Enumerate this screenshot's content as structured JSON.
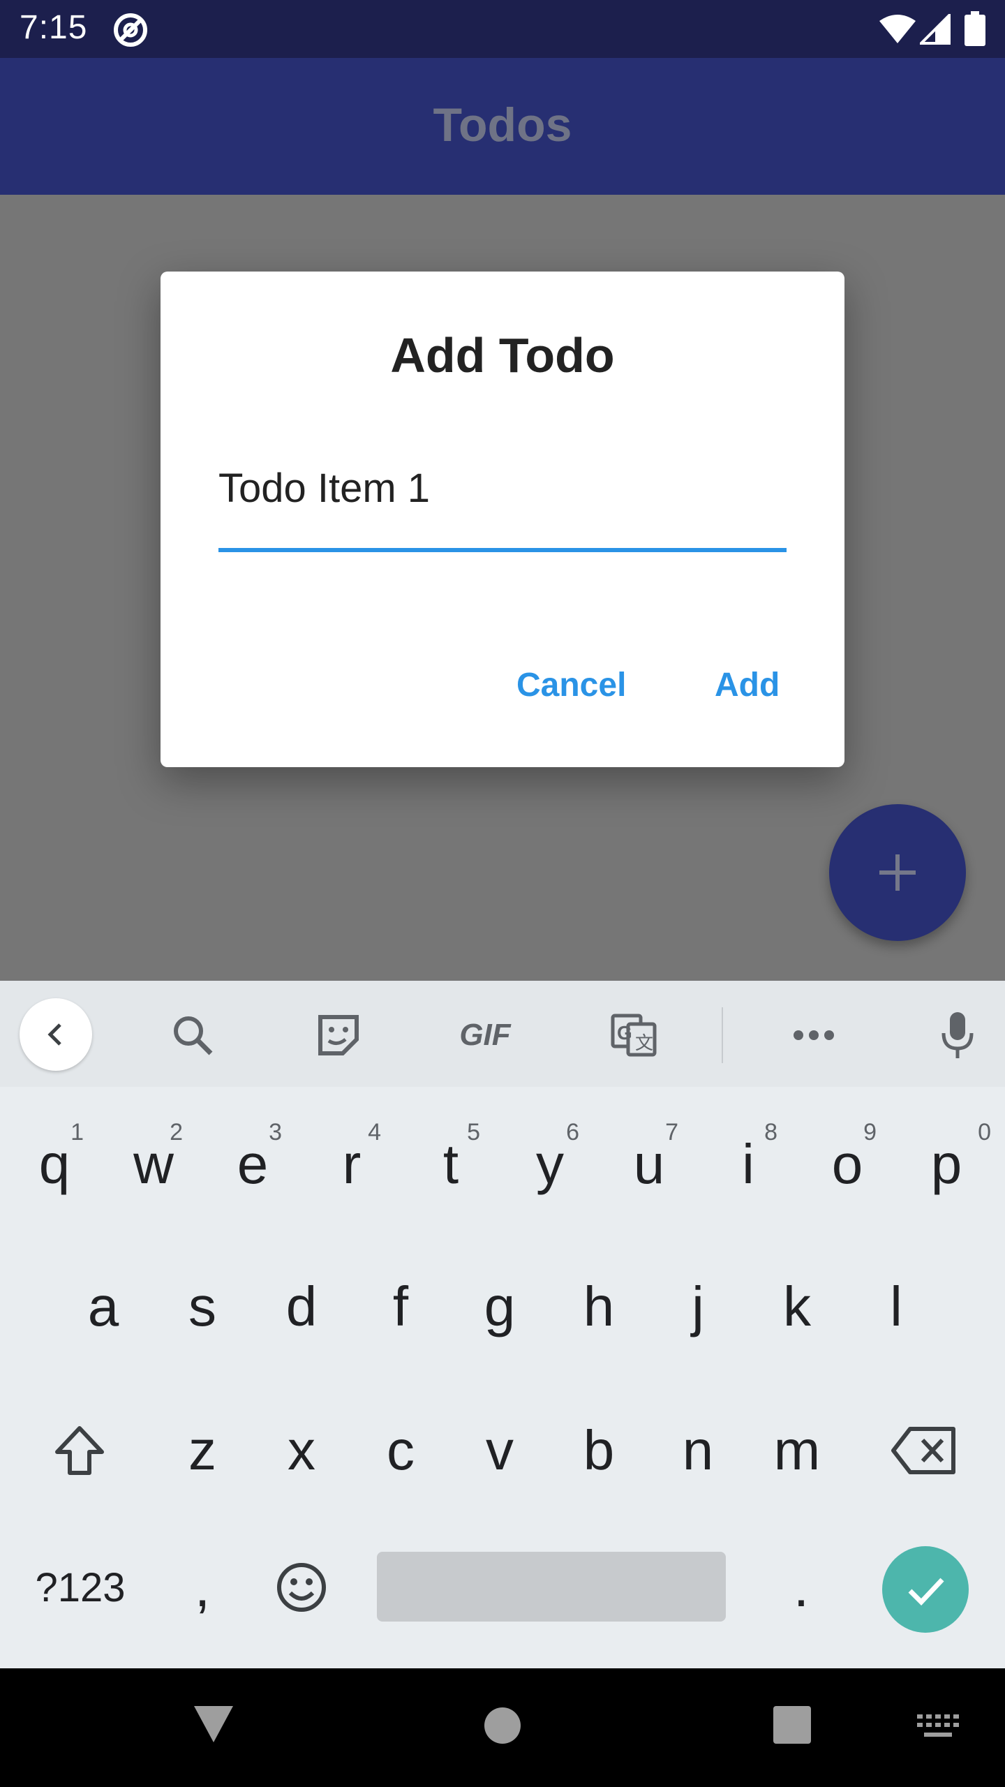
{
  "status_bar": {
    "time": "7:15"
  },
  "app_bar": {
    "title": "Todos"
  },
  "dialog": {
    "title": "Add Todo",
    "input_value": "Todo Item 1",
    "cancel_label": "Cancel",
    "add_label": "Add"
  },
  "keyboard": {
    "strip_icons": [
      "back-icon",
      "search-icon",
      "sticker-icon",
      "gif-icon",
      "translate-icon",
      "more-icon",
      "mic-icon"
    ],
    "gif_label": "GIF",
    "row1": [
      {
        "key": "q",
        "hint": "1"
      },
      {
        "key": "w",
        "hint": "2"
      },
      {
        "key": "e",
        "hint": "3"
      },
      {
        "key": "r",
        "hint": "4"
      },
      {
        "key": "t",
        "hint": "5"
      },
      {
        "key": "y",
        "hint": "6"
      },
      {
        "key": "u",
        "hint": "7"
      },
      {
        "key": "i",
        "hint": "8"
      },
      {
        "key": "o",
        "hint": "9"
      },
      {
        "key": "p",
        "hint": "0"
      }
    ],
    "row2": [
      "a",
      "s",
      "d",
      "f",
      "g",
      "h",
      "j",
      "k",
      "l"
    ],
    "row3": [
      "z",
      "x",
      "c",
      "v",
      "b",
      "n",
      "m"
    ],
    "symbols_label": "?123",
    "comma_label": ",",
    "period_label": "."
  },
  "colors": {
    "primary": "#272f72",
    "accent": "#2a93e6",
    "enter": "#4db6ac"
  }
}
